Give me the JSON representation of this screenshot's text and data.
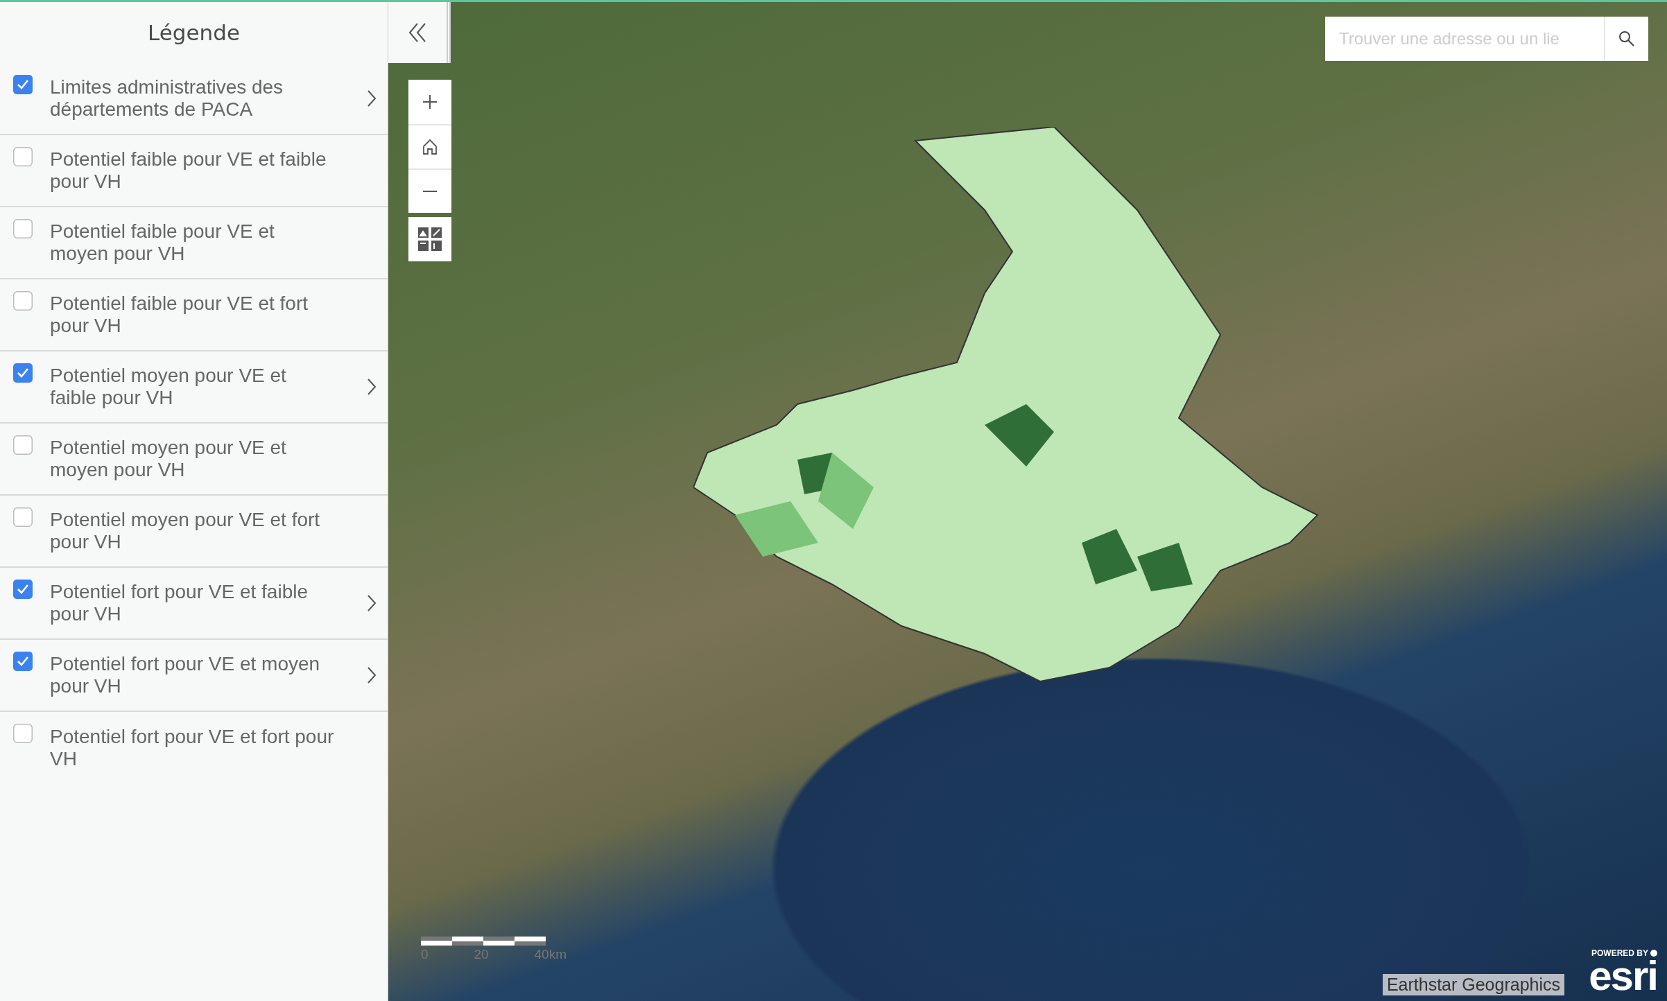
{
  "legend": {
    "title": "Légende",
    "layers": [
      {
        "label": "Limites administratives des départements de PACA",
        "checked": true
      },
      {
        "label": "Potentiel faible pour VE et faible pour VH",
        "checked": false
      },
      {
        "label": "Potentiel faible pour VE et moyen pour VH",
        "checked": false
      },
      {
        "label": "Potentiel faible pour VE et fort pour VH",
        "checked": false
      },
      {
        "label": "Potentiel moyen pour VE et faible pour VH",
        "checked": true
      },
      {
        "label": "Potentiel moyen pour VE et moyen pour VH",
        "checked": false
      },
      {
        "label": "Potentiel moyen pour VE et fort pour VH",
        "checked": false
      },
      {
        "label": "Potentiel fort pour VE et faible pour VH",
        "checked": true
      },
      {
        "label": "Potentiel fort pour VE et moyen pour VH",
        "checked": true
      },
      {
        "label": "Potentiel fort pour VE et fort pour VH",
        "checked": false
      }
    ]
  },
  "map": {
    "search": {
      "placeholder": "Trouver une adresse ou un lie"
    },
    "scale_bar": {
      "labels": [
        "0",
        "20",
        "40km"
      ]
    },
    "attribution": "Earthstar Geographics",
    "logo": {
      "tagline": "POWERED BY",
      "name": "esri"
    }
  }
}
